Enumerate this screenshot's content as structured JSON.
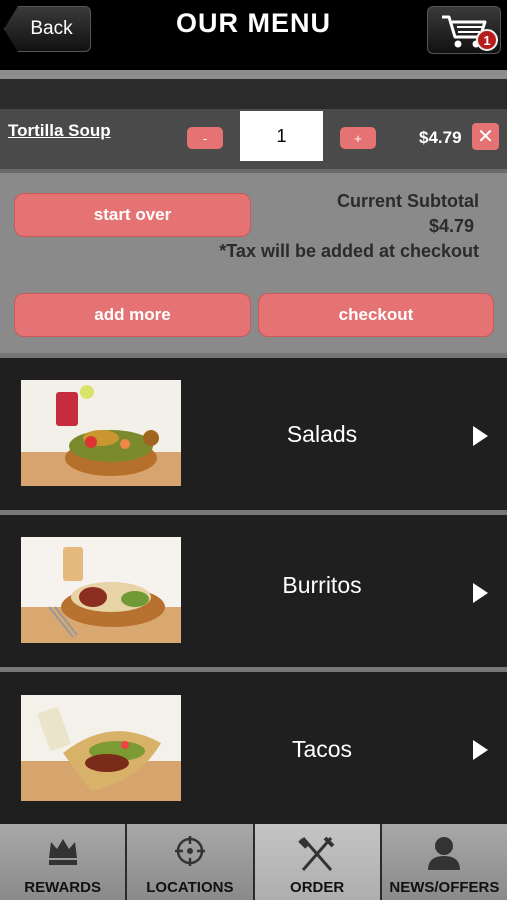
{
  "header": {
    "back_label": "Back",
    "title": "OUR MENU",
    "cart_count": "1"
  },
  "cart_item": {
    "name": "Tortilla Soup",
    "minus_label": "-",
    "plus_label": "+",
    "quantity": "1",
    "price": "$4.79",
    "remove_label": "✕"
  },
  "summary": {
    "start_over_label": "start over",
    "subtotal_label": "Current Subtotal",
    "subtotal_value": "$4.79",
    "tax_note": "*Tax will be added at checkout",
    "add_more_label": "add more",
    "checkout_label": "checkout"
  },
  "categories": [
    {
      "label": "Salads"
    },
    {
      "label": "Burritos"
    },
    {
      "label": "Tacos"
    }
  ],
  "nav": [
    {
      "label": "REWARDS",
      "icon": "crown-icon"
    },
    {
      "label": "LOCATIONS",
      "icon": "crosshair-icon"
    },
    {
      "label": "ORDER",
      "icon": "fork-knife-icon"
    },
    {
      "label": "NEWS/OFFERS",
      "icon": "person-icon"
    }
  ],
  "colors": {
    "accent": "#e57373",
    "panel": "#8a8a8a",
    "header": "#000000"
  }
}
